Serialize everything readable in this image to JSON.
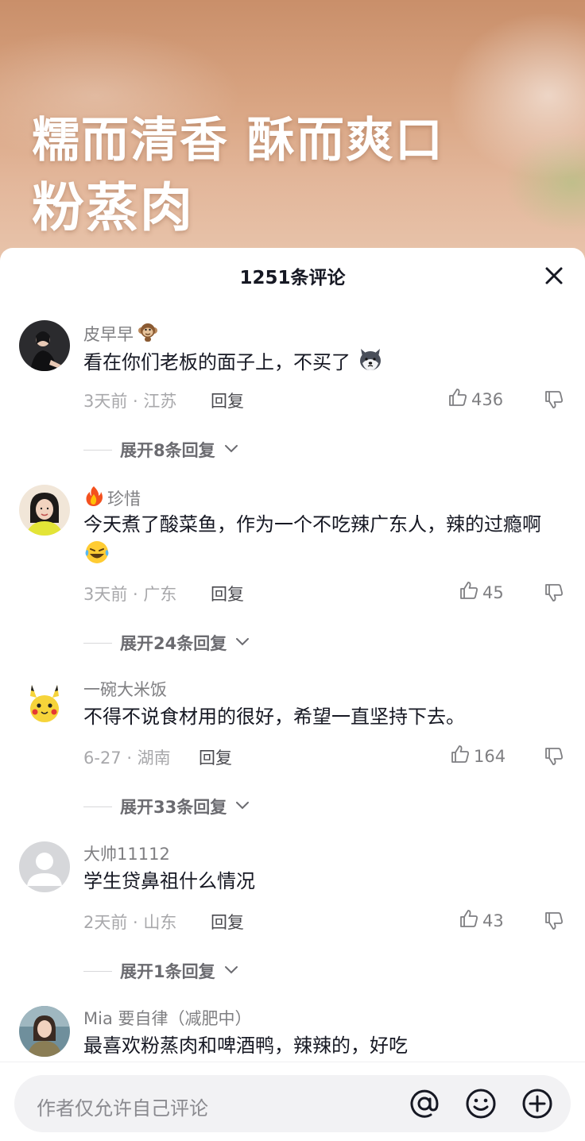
{
  "banner": {
    "line1": "糯而清香 酥而爽口",
    "line2": "粉蒸肉"
  },
  "sheet": {
    "title": "1251条评论",
    "close_icon": "close-icon"
  },
  "comments": [
    {
      "username": "皮早早",
      "username_emoji": "monkey-emoji",
      "content": "看在你们老板的面子上，不买了",
      "content_emoji": "husky-emoji",
      "meta": "3天前 · 江苏",
      "reply_label": "回复",
      "likes": "436",
      "expand_label": "展开8条回复"
    },
    {
      "username": "珍惜",
      "username_emoji": "fire-emoji",
      "content": "今天煮了酸菜鱼，作为一个不吃辣广东人，辣的过瘾啊",
      "content_emoji": "crying-laughing-emoji",
      "meta": "3天前 · 广东",
      "reply_label": "回复",
      "likes": "45",
      "expand_label": "展开24条回复"
    },
    {
      "username": "一碗大米饭",
      "content": "不得不说食材用的很好，希望一直坚持下去。",
      "meta": "6-27 · 湖南",
      "reply_label": "回复",
      "likes": "164",
      "expand_label": "展开33条回复"
    },
    {
      "username": "大帅11112",
      "content": "学生贷鼻祖什么情况",
      "meta": "2天前 · 山东",
      "reply_label": "回复",
      "likes": "43",
      "expand_label": "展开1条回复"
    },
    {
      "username": "Mia 要自律（减肥中）",
      "content": "最喜欢粉蒸肉和啤酒鸭，辣辣的，好吃"
    }
  ],
  "input": {
    "placeholder": "作者仅允许自己评论",
    "icons": [
      "at-icon",
      "smiley-icon",
      "plus-circle-icon"
    ]
  },
  "colors": {
    "text_primary": "#161823",
    "text_secondary": "#7f7f82",
    "text_meta": "#a8a8ab",
    "input_bg": "#f2f2f4"
  }
}
